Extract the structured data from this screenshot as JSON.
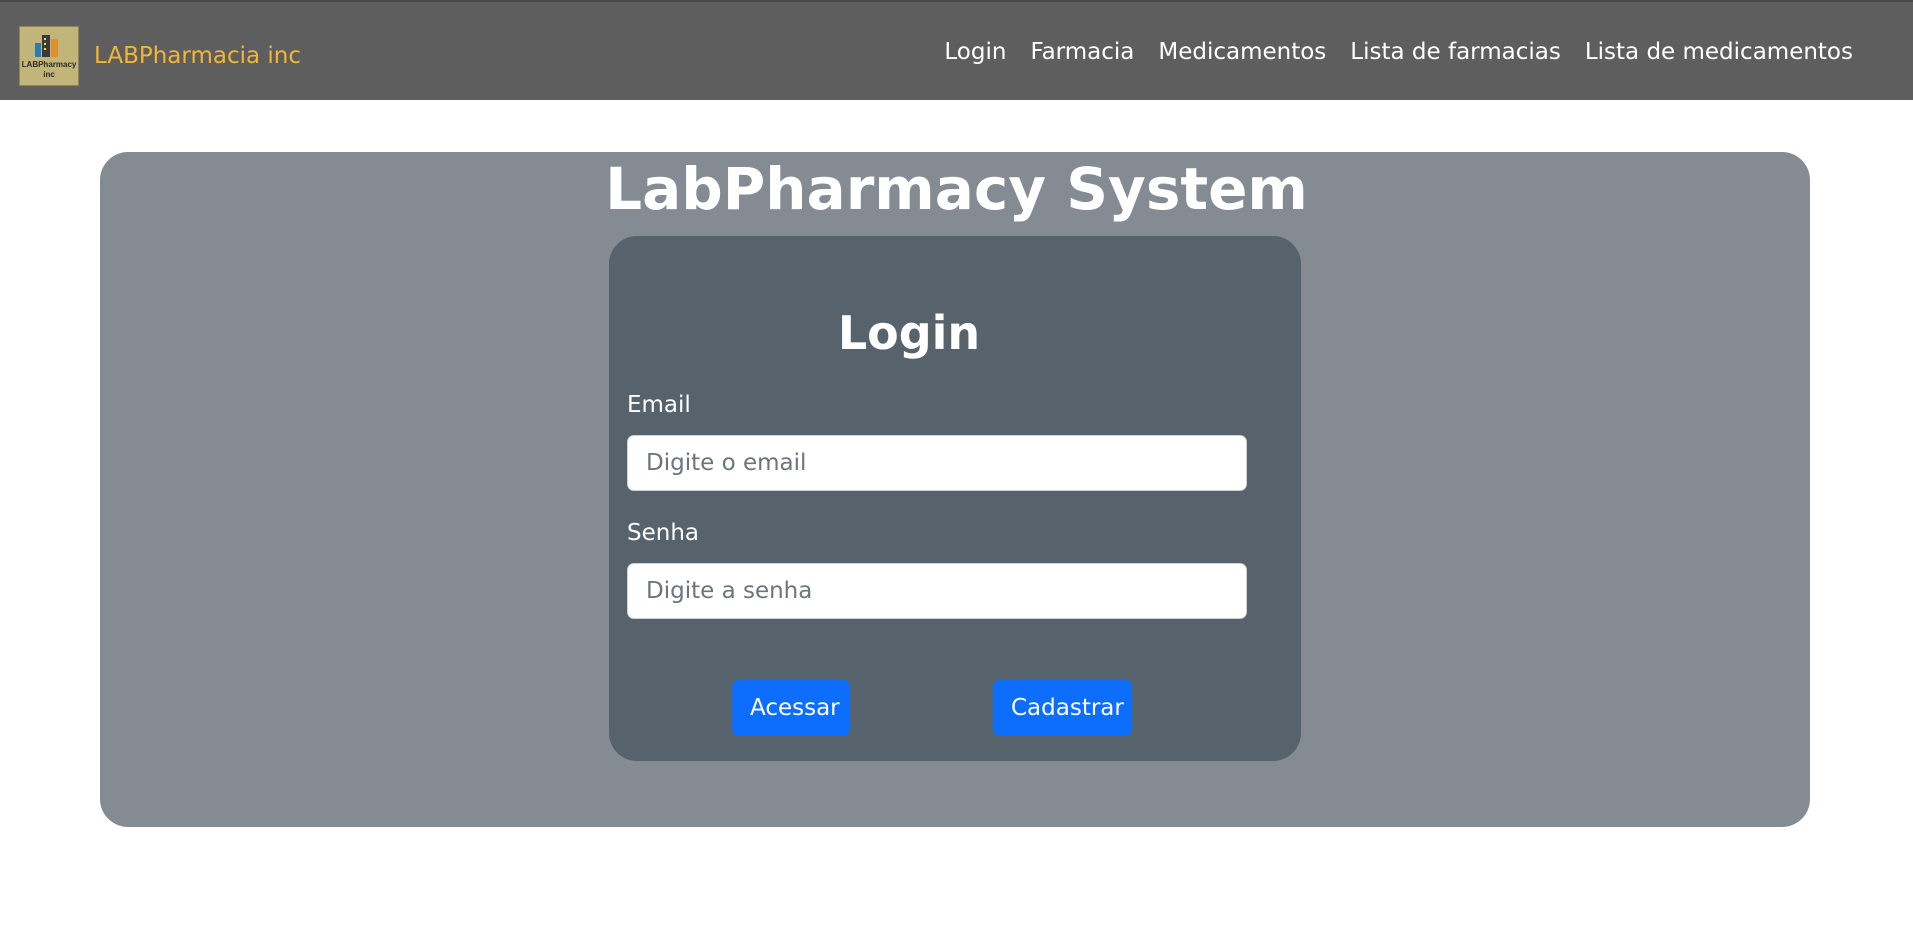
{
  "navbar": {
    "brand_name": "LABPharmacia inc",
    "logo_text_line1": "LABPharmacy",
    "logo_text_line2": "inc",
    "links": [
      "Login",
      "Farmacia",
      "Medicamentos",
      "Lista de farmacias",
      "Lista de medicamentos"
    ]
  },
  "main": {
    "title": "LabPharmacy System"
  },
  "login": {
    "title": "Login",
    "email_label": "Email",
    "email_placeholder": "Digite o email",
    "email_value": "",
    "password_label": "Senha",
    "password_placeholder": "Digite a senha",
    "password_value": "",
    "submit_label": "Acessar",
    "register_label": "Cadastrar"
  },
  "colors": {
    "navbar_bg": "#5e5e5e",
    "brand_text": "#f2b632",
    "panel_bg": "#848b93",
    "card_bg": "#56626c",
    "button_primary": "#0d6efd"
  }
}
